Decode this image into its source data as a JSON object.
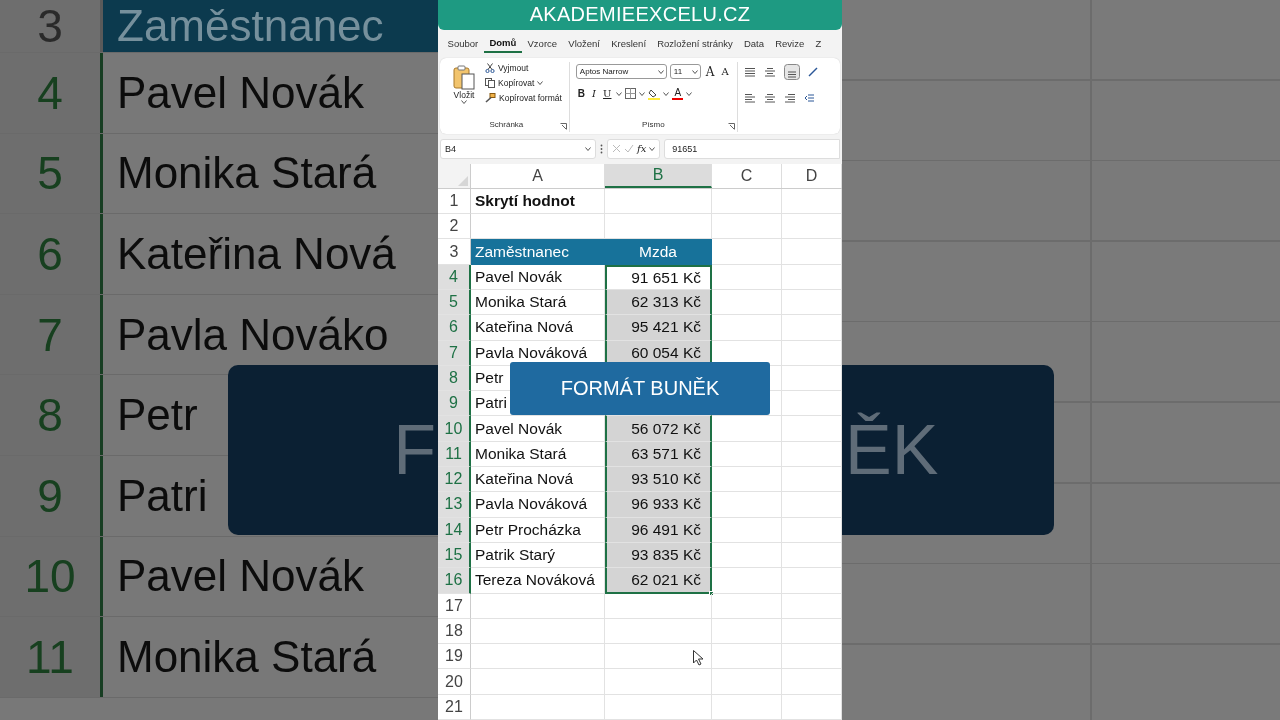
{
  "backdrop": {
    "left_rows": [
      {
        "n": "3",
        "a": "Zaměstnanec",
        "kind": "header"
      },
      {
        "n": "4",
        "a": "Pavel Novák",
        "kind": "data"
      },
      {
        "n": "5",
        "a": "Monika Stará",
        "kind": "data"
      },
      {
        "n": "6",
        "a": "Kateřina Nová",
        "kind": "data"
      },
      {
        "n": "7",
        "a": "Pavla Nováko",
        "kind": "data"
      },
      {
        "n": "8",
        "a": "Petr",
        "kind": "data"
      },
      {
        "n": "9",
        "a": "Patri",
        "kind": "data"
      },
      {
        "n": "10",
        "a": "Pavel Novák",
        "kind": "data"
      },
      {
        "n": "11",
        "a": "Monika Stará",
        "kind": "data"
      }
    ],
    "banner_left": "F",
    "banner_right": "ĚK"
  },
  "brand": "AKADEMIEEXCELU.CZ",
  "ribbon": {
    "tabs": [
      {
        "label": "Soubor",
        "selected": false
      },
      {
        "label": "Domů",
        "selected": true
      },
      {
        "label": "Vzorce",
        "selected": false
      },
      {
        "label": "Vložení",
        "selected": false
      },
      {
        "label": "Kreslení",
        "selected": false
      },
      {
        "label": "Rozložení stránky",
        "selected": false
      },
      {
        "label": "Data",
        "selected": false
      },
      {
        "label": "Revize",
        "selected": false
      },
      {
        "label": "Z",
        "selected": false
      }
    ],
    "clipboard": {
      "paste": "Vložit",
      "cut": "Vyjmout",
      "copy": "Kopírovat",
      "format_painter": "Kopírovat formát",
      "label": "Schránka"
    },
    "font": {
      "name": "Aptos Narrow",
      "size": "11",
      "grow": "A",
      "shrink": "A",
      "bold": "B",
      "italic": "I",
      "underline": "U",
      "color_letter": "A",
      "label": "Písmo"
    }
  },
  "formula_bar": {
    "name_box": "B4",
    "fx": "fx",
    "value": "91651"
  },
  "sheet": {
    "columns": [
      {
        "label": "A",
        "selected": false
      },
      {
        "label": "B",
        "selected": true
      },
      {
        "label": "C",
        "selected": false
      },
      {
        "label": "D",
        "selected": false
      }
    ],
    "rows": [
      {
        "n": "1",
        "kind": "title",
        "a": "Skrytí hodnot",
        "selected": false
      },
      {
        "n": "2",
        "kind": "blank",
        "selected": false
      },
      {
        "n": "3",
        "kind": "header",
        "a": "Zaměstnanec",
        "b": "Mzda",
        "selected": false
      },
      {
        "n": "4",
        "kind": "data",
        "a": "Pavel Novák",
        "b": "91 651 Kč",
        "selected": true,
        "active": true
      },
      {
        "n": "5",
        "kind": "data",
        "a": "Monika Stará",
        "b": "62 313 Kč",
        "selected": true,
        "active": false
      },
      {
        "n": "6",
        "kind": "data",
        "a": "Kateřina Nová",
        "b": "95 421 Kč",
        "selected": true,
        "active": false
      },
      {
        "n": "7",
        "kind": "data",
        "a": "Pavla Nováková",
        "b": "60 054 Kč",
        "selected": true,
        "active": false
      },
      {
        "n": "8",
        "kind": "data",
        "a": "Petr",
        "selected": true,
        "active": false
      },
      {
        "n": "9",
        "kind": "data",
        "a": "Patri",
        "selected": true,
        "active": false
      },
      {
        "n": "10",
        "kind": "data",
        "a": "Pavel Novák",
        "b": "56 072 Kč",
        "selected": true,
        "active": false
      },
      {
        "n": "11",
        "kind": "data",
        "a": "Monika Stará",
        "b": "63 571 Kč",
        "selected": true,
        "active": false
      },
      {
        "n": "12",
        "kind": "data",
        "a": "Kateřina Nová",
        "b": "93 510 Kč",
        "selected": true,
        "active": false
      },
      {
        "n": "13",
        "kind": "data",
        "a": "Pavla Nováková",
        "b": "96 933 Kč",
        "selected": true,
        "active": false
      },
      {
        "n": "14",
        "kind": "data",
        "a": "Petr Procházka",
        "b": "96 491 Kč",
        "selected": true,
        "active": false
      },
      {
        "n": "15",
        "kind": "data",
        "a": "Patrik Starý",
        "b": "93 835 Kč",
        "selected": true,
        "active": false
      },
      {
        "n": "16",
        "kind": "data",
        "a": "Tereza Nováková",
        "b": "62 021 Kč",
        "selected": true,
        "active": false
      },
      {
        "n": "17",
        "kind": "blank",
        "selected": false
      },
      {
        "n": "18",
        "kind": "blank",
        "selected": false
      },
      {
        "n": "19",
        "kind": "blank",
        "selected": false
      },
      {
        "n": "20",
        "kind": "blank",
        "selected": false
      },
      {
        "n": "21",
        "kind": "blank",
        "selected": false
      }
    ]
  },
  "caption": "FORMÁT BUNĚK"
}
